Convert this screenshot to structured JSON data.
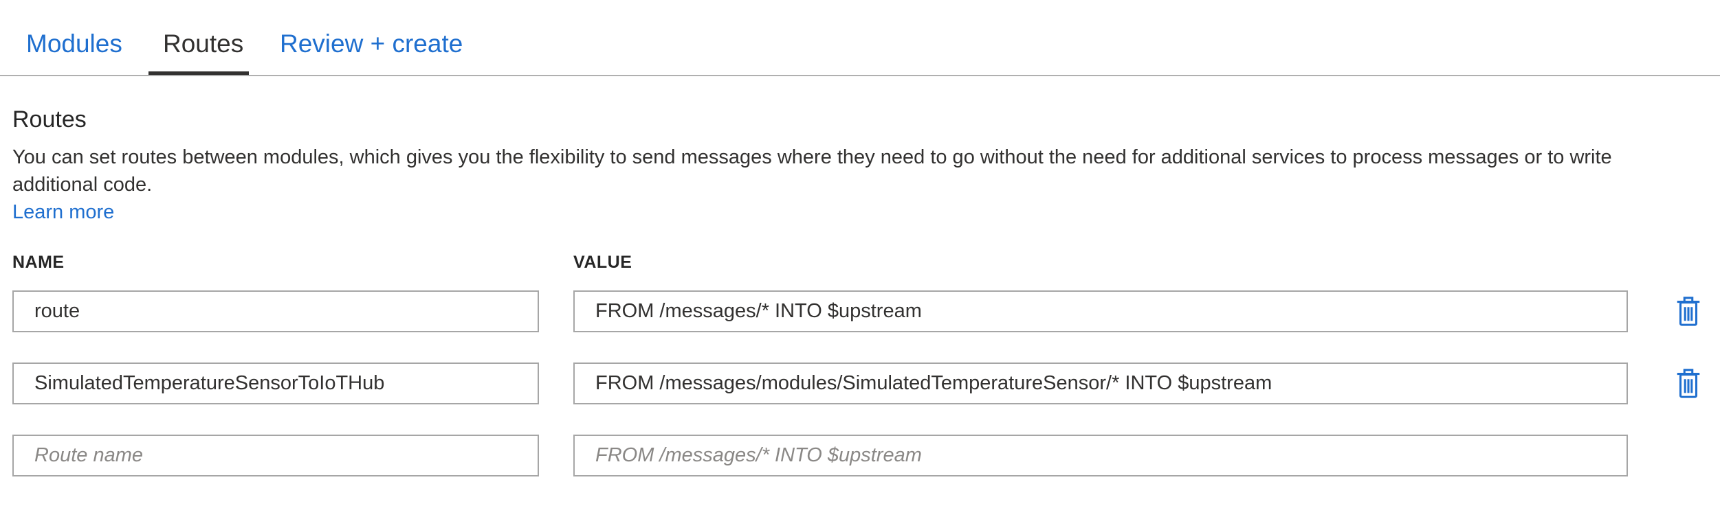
{
  "tabs": [
    {
      "label": "Modules",
      "active": false
    },
    {
      "label": "Routes",
      "active": true
    },
    {
      "label": "Review + create",
      "active": false
    }
  ],
  "section": {
    "title": "Routes",
    "description": "You can set routes between modules, which gives you the flexibility to send messages where they need to go without the need for additional services to process messages or to write additional code.",
    "learn_more": "Learn more"
  },
  "columns": {
    "name": "NAME",
    "value": "VALUE"
  },
  "routes": [
    {
      "name": "route",
      "value": "FROM /messages/* INTO $upstream"
    },
    {
      "name": "SimulatedTemperatureSensorToIoTHub",
      "value": "FROM /messages/modules/SimulatedTemperatureSensor/* INTO $upstream"
    }
  ],
  "new_route": {
    "name_placeholder": "Route name",
    "value_placeholder": "FROM /messages/* INTO $upstream"
  },
  "icons": {
    "delete": "trash-icon"
  },
  "colors": {
    "link": "#1f6fcf",
    "text": "#323130",
    "border": "#a6a6a6"
  }
}
